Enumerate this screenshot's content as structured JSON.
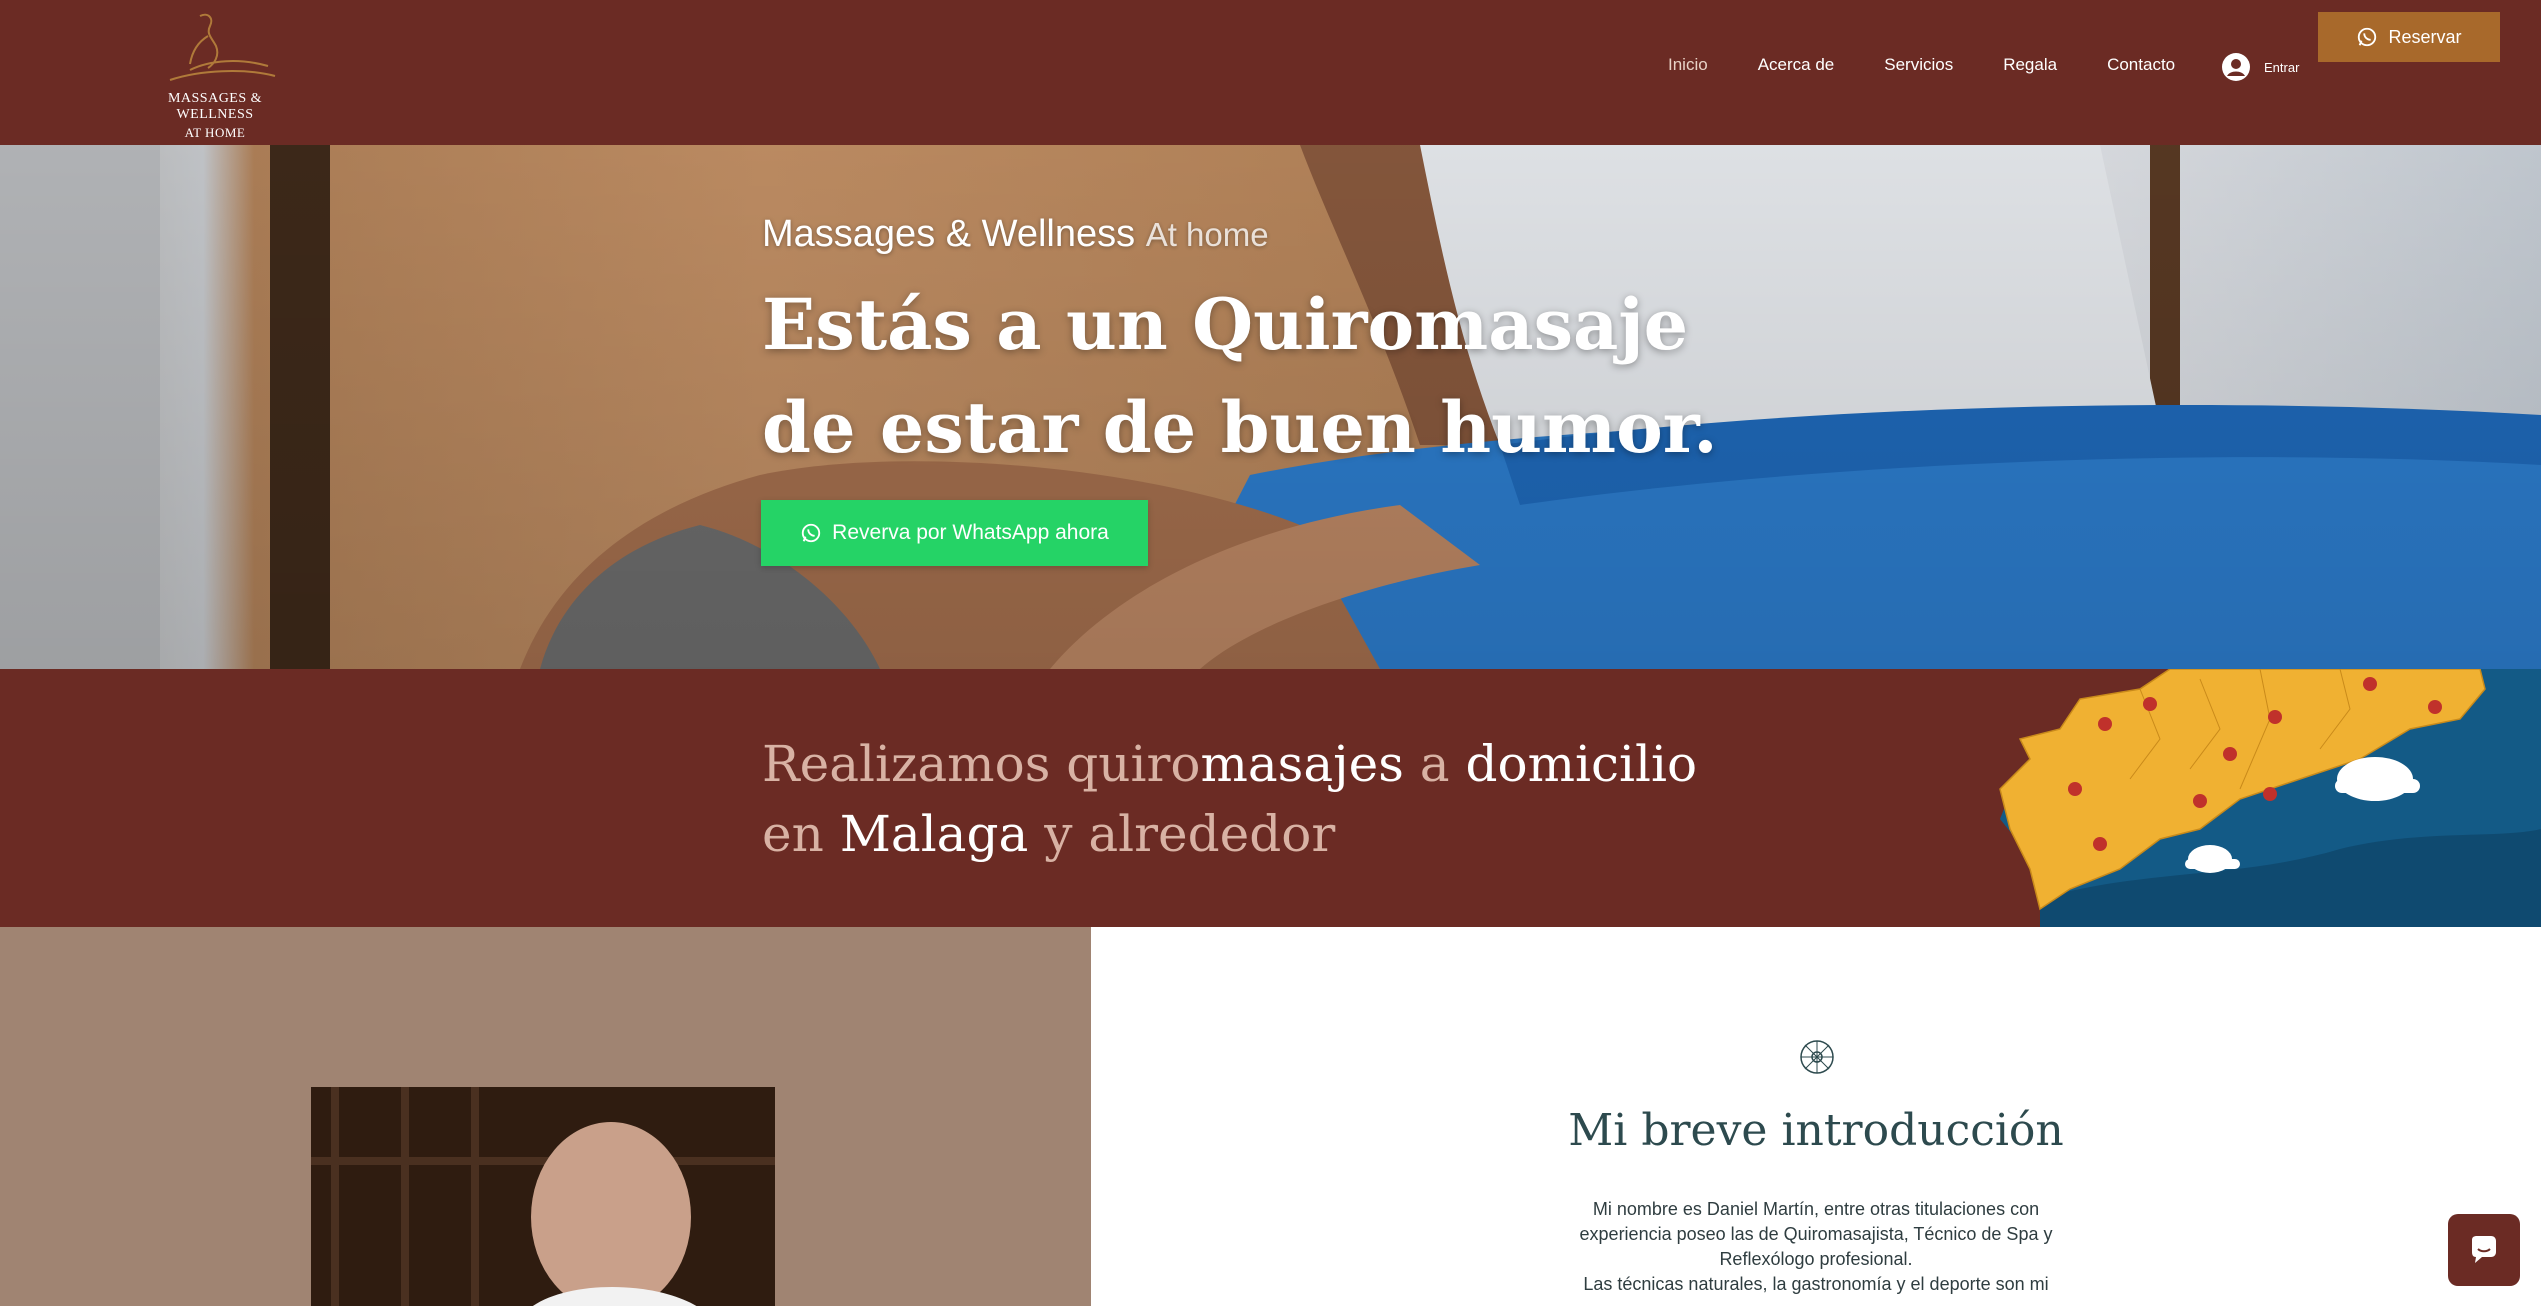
{
  "logo": {
    "line1": "MASSAGES & WELLNESS",
    "line2": "AT HOME"
  },
  "nav": {
    "items": [
      {
        "label": "Inicio",
        "active": true
      },
      {
        "label": "Acerca de"
      },
      {
        "label": "Servicios"
      },
      {
        "label": "Regala"
      },
      {
        "label": "Contacto"
      }
    ],
    "login_label": "Entrar",
    "reserve_label": "Reservar"
  },
  "hero": {
    "subtitle_main": "Massages & Wellness",
    "subtitle_small": "At home",
    "title_line1": "Estás a un Quiromasaje",
    "title_line2": "de estar de buen humor.",
    "whatsapp_button": "Reverva por WhatsApp ahora"
  },
  "banner": {
    "w1": "Realizamos quiro",
    "w2": "masajes",
    "w3": " a ",
    "w4": "domicilio",
    "w5": "en ",
    "w6": "Malaga",
    "w7": " y alrededor"
  },
  "intro": {
    "title": "Mi breve introducción",
    "line1": "Mi nombre es Daniel Martín, entre otras titulaciones con",
    "line2": "experiencia poseo las de Quiromasajista, Técnico de Spa y",
    "line3": "Reflexólogo profesional.",
    "line4": "Las técnicas naturales, la gastronomía y el deporte son mi"
  },
  "colors": {
    "header_bg": "#6b2b24",
    "reserve_bg": "#a8692b",
    "whatsapp_green": "#25d366",
    "intro_title": "#2d4a4e"
  }
}
